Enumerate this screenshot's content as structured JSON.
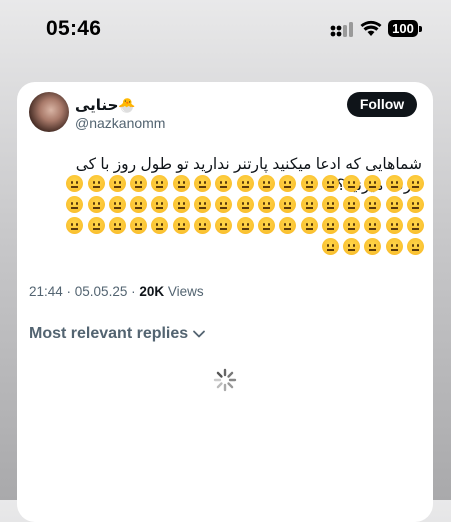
{
  "status_bar": {
    "time": "05:46",
    "battery": "100",
    "icons": [
      "cellular-signal-icon",
      "wifi-icon",
      "battery-icon"
    ]
  },
  "tweet": {
    "display_name": "حنایی",
    "name_emoji": "🐣",
    "handle": "@nazkanomm",
    "follow_label": "Follow",
    "text": "شماهایی که ادعا میکنید پارتنر ندارید تو طول روز با کی حرف میزنید؟",
    "emoji_name": "neutral-face-emoji",
    "emoji_count": 56,
    "timestamp": "21:44 · 05.05.25 · ",
    "views_count": "20K",
    "views_label": " Views"
  },
  "replies": {
    "sort_label": "Most relevant replies"
  },
  "colors": {
    "follow_bg": "#0f1419",
    "text_primary": "#0f1419",
    "text_secondary": "#536471",
    "emoji_yellow": "#f9bd2c"
  }
}
